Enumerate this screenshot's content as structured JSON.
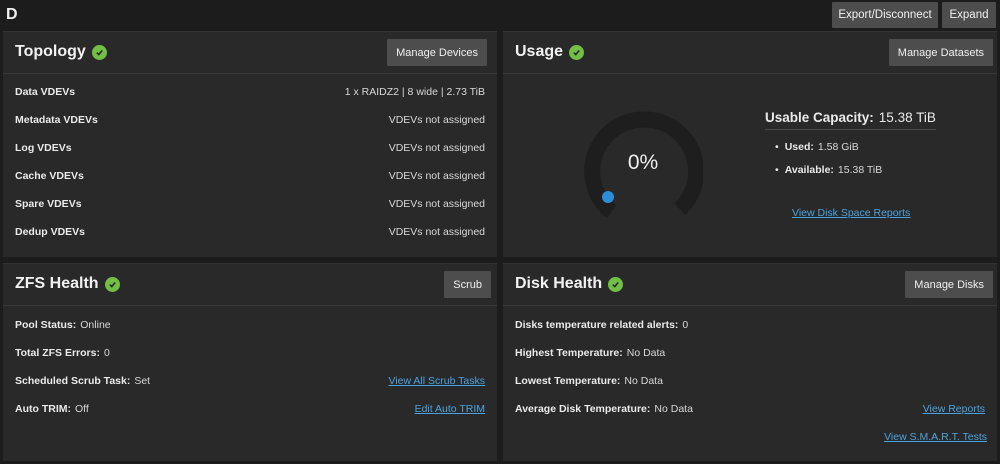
{
  "pool": {
    "name": "D"
  },
  "header": {
    "export_label": "Export/Disconnect",
    "expand_label": "Expand"
  },
  "topology": {
    "title": "Topology",
    "button": "Manage Devices",
    "rows": [
      {
        "label": "Data VDEVs",
        "value": "1 x RAIDZ2 | 8 wide | 2.73 TiB"
      },
      {
        "label": "Metadata VDEVs",
        "value": "VDEVs not assigned"
      },
      {
        "label": "Log VDEVs",
        "value": "VDEVs not assigned"
      },
      {
        "label": "Cache VDEVs",
        "value": "VDEVs not assigned"
      },
      {
        "label": "Spare VDEVs",
        "value": "VDEVs not assigned"
      },
      {
        "label": "Dedup VDEVs",
        "value": "VDEVs not assigned"
      }
    ]
  },
  "usage": {
    "title": "Usage",
    "button": "Manage Datasets",
    "percent": "0%",
    "percent_value": 0,
    "usable_label": "Usable Capacity:",
    "usable_value": "15.38 TiB",
    "used_label": "Used:",
    "used_value": "1.58 GiB",
    "available_label": "Available:",
    "available_value": "15.38 TiB",
    "report_link": "View Disk Space Reports",
    "gauge_color": "#2a8fd6"
  },
  "zfs_health": {
    "title": "ZFS Health",
    "button": "Scrub",
    "pool_status_label": "Pool Status:",
    "pool_status_value": "Online",
    "errors_label": "Total ZFS Errors:",
    "errors_value": "0",
    "scrub_label": "Scheduled Scrub Task:",
    "scrub_value": "Set",
    "scrub_link": "View All Scrub Tasks",
    "trim_label": "Auto TRIM:",
    "trim_value": "Off",
    "trim_link": "Edit Auto TRIM"
  },
  "disk_health": {
    "title": "Disk Health",
    "button": "Manage Disks",
    "alerts_label": "Disks temperature related alerts:",
    "alerts_value": "0",
    "highest_label": "Highest Temperature:",
    "highest_value": "No Data",
    "lowest_label": "Lowest Temperature:",
    "lowest_value": "No Data",
    "average_label": "Average Disk Temperature:",
    "average_value": "No Data",
    "reports_link": "View Reports",
    "smart_link": "View S.M.A.R.T. Tests"
  },
  "colors": {
    "ok_check": "#71bf44",
    "link": "#4aa3df",
    "button_bg": "#4d4d4d",
    "card_bg": "#292929"
  }
}
